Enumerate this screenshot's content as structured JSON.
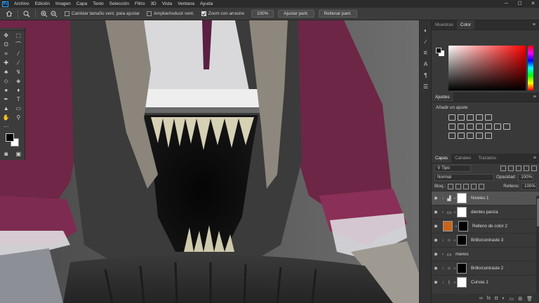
{
  "menu": {
    "app_badge": "Ps",
    "items": [
      "Archivo",
      "Edición",
      "Imagen",
      "Capa",
      "Texto",
      "Selección",
      "Filtro",
      "3D",
      "Vista",
      "Ventana",
      "Ayuda"
    ]
  },
  "options": {
    "resize_windows_label": "Cambiar tamaño vent. para ajustar",
    "resize_windows_checked": false,
    "zoom_all_label": "Ampliar/reducir vent.",
    "zoom_all_checked": false,
    "scrubby_label": "Zoom con arrastre",
    "scrubby_checked": true,
    "zoom_value": "100%",
    "fit_screen": "Ajustar pant.",
    "fill_screen": "Rellenar pant."
  },
  "panels": {
    "swatches_tab": "Muestras",
    "color_tab": "Color",
    "adjustments_tab": "Ajustes",
    "add_adjustment": "Añadir un ajuste"
  },
  "layers_panel": {
    "tabs": [
      "Capas",
      "Canales",
      "Trazados"
    ],
    "filter_kind": "Tipo",
    "blend_mode": "Normal",
    "opacity_label": "Opacidad:",
    "opacity_value": "100%",
    "lock_label": "Bloq.:",
    "fill_label": "Relleno:",
    "fill_value": "100%",
    "layers": [
      {
        "name": "Niveles 1",
        "selected": true
      },
      {
        "name": "dientes panza"
      },
      {
        "name": "Relleno de color 2"
      },
      {
        "name": "Brillo/contraste 3"
      },
      {
        "name": "manos"
      },
      {
        "name": "Brillo/contraste 2"
      },
      {
        "name": "Curvas 1"
      }
    ]
  },
  "colors": {
    "fill_layer_color": "#c8641a",
    "dress_purple": "#7a2b4e"
  }
}
